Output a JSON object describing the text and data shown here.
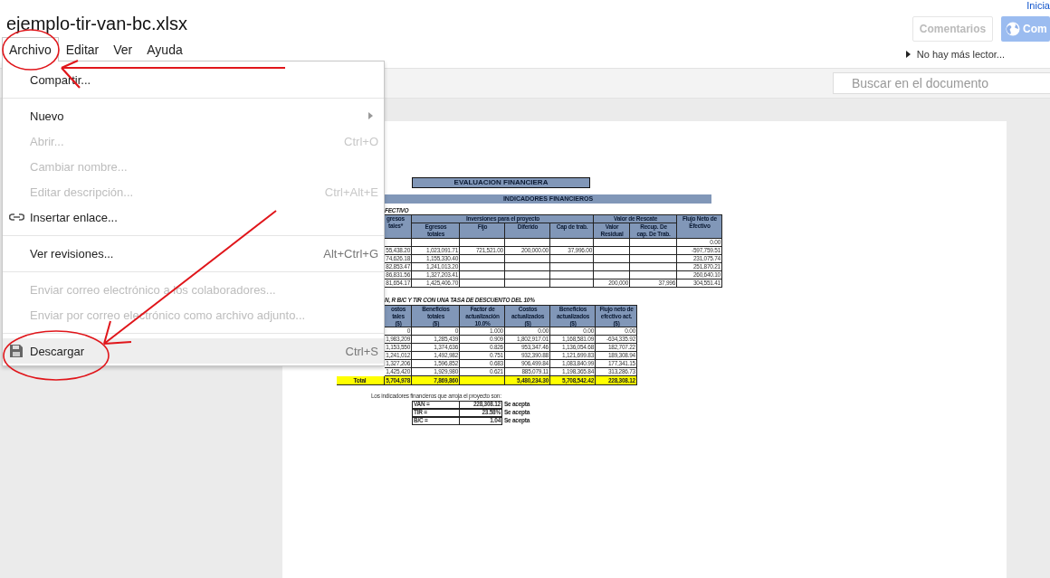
{
  "document": {
    "title": "ejemplo-tir-van-bc.xlsx"
  },
  "menu_bar": [
    {
      "label": "Archivo",
      "selected": true
    },
    {
      "label": "Editar",
      "selected": false
    },
    {
      "label": "Ver",
      "selected": false
    },
    {
      "label": "Ayuda",
      "selected": false
    }
  ],
  "account": {
    "sign_in_link": "Inicia"
  },
  "buttons": [
    {
      "kind": "plain",
      "label": "Comentarios"
    },
    {
      "kind": "share",
      "label": "Com"
    }
  ],
  "readers": {
    "label": "No hay más lector..."
  },
  "search": {
    "placeholder": "Buscar en el documento"
  },
  "file_menu": [
    {
      "kind": "item",
      "label": "Compartir...",
      "disabled": false,
      "selected": false,
      "submenu": false
    },
    {
      "kind": "separator"
    },
    {
      "kind": "item",
      "label": "Nuevo",
      "disabled": false,
      "selected": false,
      "submenu": true
    },
    {
      "kind": "item",
      "label": "Abrir...",
      "shortcut": "Ctrl+O",
      "disabled": true,
      "selected": false,
      "submenu": false
    },
    {
      "kind": "item",
      "label": "Cambiar nombre...",
      "disabled": true,
      "selected": false,
      "submenu": false
    },
    {
      "kind": "item",
      "label": "Editar descripción...",
      "shortcut": "Ctrl+Alt+E",
      "disabled": true,
      "selected": false,
      "submenu": false
    },
    {
      "kind": "link",
      "label": "Insertar enlace...",
      "disabled": false,
      "selected": false,
      "submenu": false
    },
    {
      "kind": "separator"
    },
    {
      "kind": "item",
      "label": "Ver revisiones...",
      "shortcut": "Alt+Ctrl+G",
      "disabled": false,
      "selected": false,
      "submenu": false
    },
    {
      "kind": "separator"
    },
    {
      "kind": "item",
      "label": "Enviar correo electrónico a los colaboradores...",
      "disabled": true,
      "selected": false,
      "submenu": false
    },
    {
      "kind": "item",
      "label": "Enviar por correo electrónico como archivo adjunto...",
      "disabled": true,
      "selected": false,
      "submenu": false
    },
    {
      "kind": "separator"
    },
    {
      "kind": "save",
      "label": "Descargar",
      "shortcut": "Ctrl+S",
      "disabled": false,
      "selected": true,
      "submenu": false
    }
  ],
  "sheet": {
    "title": "EVALUACION FINANCIERA",
    "subtitle": "INDICADORES FINANCIEROS",
    "cash_flow": {
      "caption": "FECTIVO",
      "group_headers": [
        {
          "label": "Inversiones para el proyecto"
        },
        {
          "label": "Valor de Rescate"
        }
      ],
      "columns": [
        {
          "label": "gresos\ntales*"
        },
        {
          "label": "Egresos\ntotales"
        },
        {
          "label": "Fijo"
        },
        {
          "label": "Diferido"
        },
        {
          "label": "Cap de trab."
        },
        {
          "label": "Valor\nResidual"
        },
        {
          "label": "Recup. De\ncap. De Trab."
        },
        {
          "label": "Flujo Neto de\nEfectivo"
        }
      ],
      "rows": [
        [
          null,
          null,
          null,
          null,
          null,
          null,
          null,
          "0.00"
        ],
        [
          "55,438.20",
          "1,023,091.71",
          "721,521.00",
          "200,000.00",
          "37,996.00",
          null,
          null,
          "-597,759.51"
        ],
        [
          "74,626.18",
          "1,155,330.40",
          null,
          null,
          null,
          null,
          null,
          "231,075.74"
        ],
        [
          "82,853.47",
          "1,241,013.20",
          null,
          null,
          null,
          null,
          null,
          "251,870.21"
        ],
        [
          "86,831.56",
          "1,327,203.41",
          null,
          null,
          null,
          null,
          null,
          "260,640.10"
        ],
        [
          "81,654.17",
          "1,425,406.70",
          null,
          null,
          null,
          "200,000",
          "37,996",
          "304,551.41"
        ]
      ]
    },
    "discount": {
      "caption": "N, R B/C Y TIR CON UNA TASA DE DESCUENTO DEL 10%",
      "columns": [
        {
          "label": "ostos\ntales\n($)"
        },
        {
          "label": "Beneficios\ntotales\n($)"
        },
        {
          "label": "Factor de\nactualización\n10.0%"
        },
        {
          "label": "Costos\nactualizados\n($)"
        },
        {
          "label": "Beneficios\nactualizados\n($)"
        },
        {
          "label": "Flujo neto de\nefectivo act.\n($)"
        }
      ],
      "rows": [
        [
          "0",
          "0",
          "1.000",
          "0.00",
          "0.00",
          "0.00"
        ],
        [
          "1,983,209",
          "1,285,439",
          "0.909",
          "1,802,917.01",
          "1,168,581.09",
          "-634,335.92"
        ],
        [
          "1,153,550",
          "1,374,636",
          "0.826",
          "953,347.46",
          "1,136,054.68",
          "182,707.22"
        ],
        [
          "1,241,012",
          "1,492,982",
          "0.751",
          "932,390.88",
          "1,121,699.83",
          "189,308.94"
        ],
        [
          "1,327,206",
          "1,596,852",
          "0.683",
          "906,499.84",
          "1,083,840.99",
          "177,341.15"
        ],
        [
          "1,425,420",
          "1,929,980",
          "0.621",
          "885,079.11",
          "1,198,365.84",
          "313,286.73"
        ]
      ],
      "total": {
        "label": "Total",
        "cells": [
          {
            "kind": "value",
            "text": "5,704,978"
          },
          {
            "kind": "value",
            "text": "7,869,860"
          },
          {
            "kind": "blank"
          },
          {
            "kind": "value",
            "text": "5,480,234.30"
          },
          {
            "kind": "value",
            "text": "5,708,542.42"
          },
          {
            "kind": "value",
            "text": "228,308.12"
          }
        ]
      }
    },
    "indicators": {
      "intro": "Los indicadores financieros que arroja el proyecto son:",
      "rows": [
        {
          "label": "VAN =",
          "value": "228,308.12",
          "verdict": "Se acepta"
        },
        {
          "label": "TIR =",
          "value": "23.58%",
          "verdict": "Se acepta"
        },
        {
          "label": "B/C =",
          "value": "1.04",
          "verdict": "Se acepta"
        }
      ]
    }
  }
}
